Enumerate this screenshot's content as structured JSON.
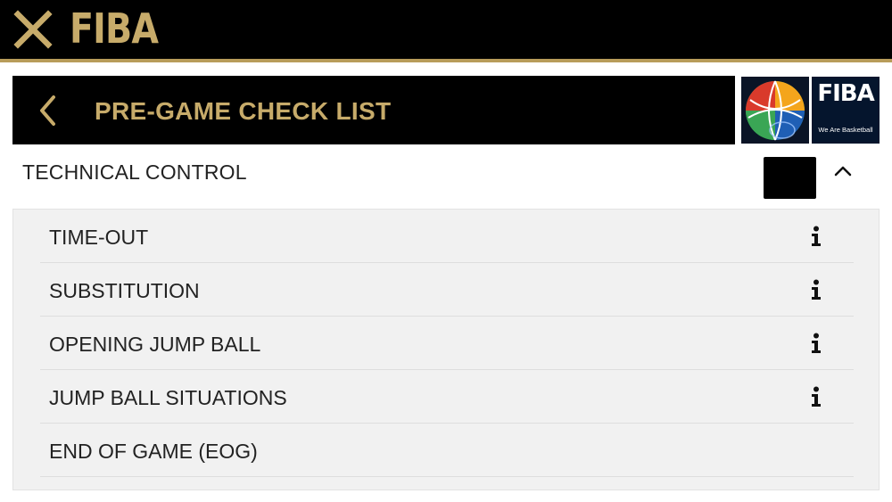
{
  "app": {
    "brand": "FIBA",
    "close_icon": "close-x-icon",
    "accent_color": "#c7ab6a"
  },
  "header": {
    "title": "PRE-GAME CHECK LIST",
    "back_icon": "chevron-left-icon"
  },
  "logos": {
    "fiba_text": "FIBA",
    "fiba_tagline": "We Are Basketball"
  },
  "section": {
    "title": "TECHNICAL CONTROL",
    "toggle_icon": "chevron-up-icon",
    "items": [
      {
        "label": "TIME-OUT",
        "icon": "info-icon"
      },
      {
        "label": "SUBSTITUTION",
        "icon": "info-icon"
      },
      {
        "label": "OPENING JUMP BALL",
        "icon": "info-icon"
      },
      {
        "label": "JUMP BALL SITUATIONS",
        "icon": "info-icon"
      },
      {
        "label": "END OF GAME (EOG)",
        "icon": null
      }
    ]
  }
}
